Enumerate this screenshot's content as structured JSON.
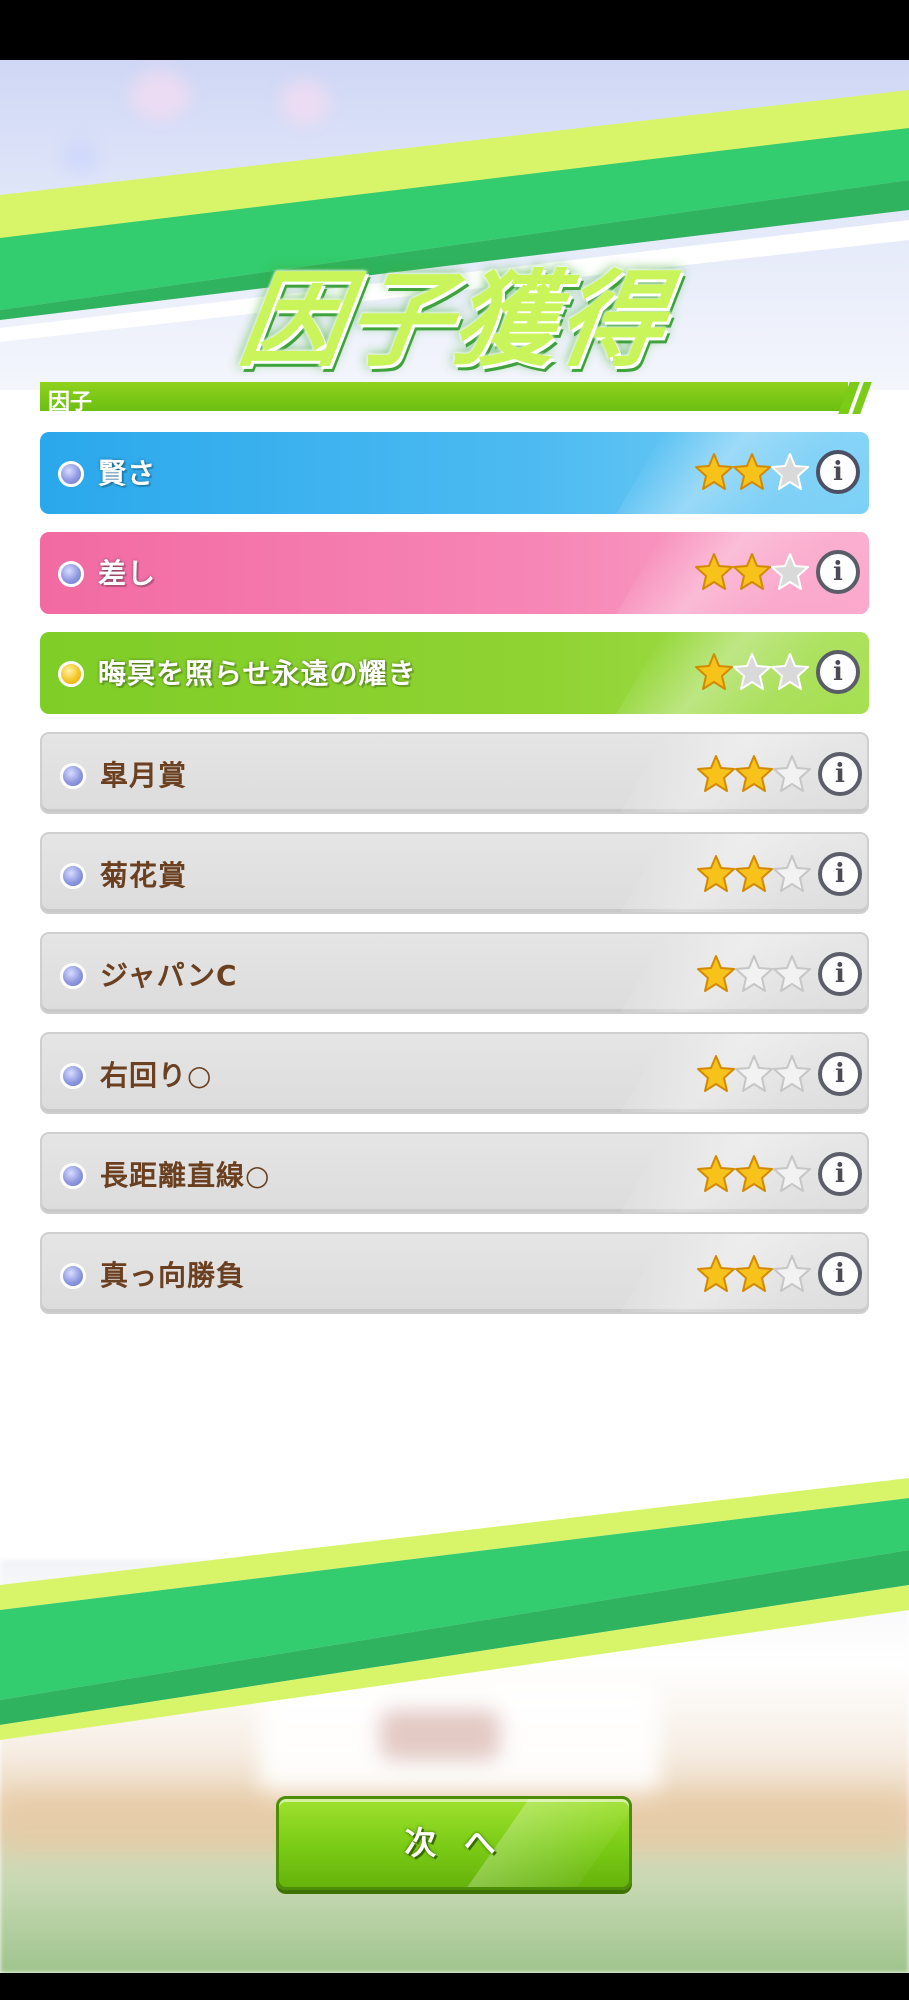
{
  "title": "因子獲得",
  "section_label": "因子",
  "factors": [
    {
      "name": "賢さ",
      "stars": 2,
      "max_stars": 3,
      "style": "blue"
    },
    {
      "name": "差し",
      "stars": 2,
      "max_stars": 3,
      "style": "pink"
    },
    {
      "name": "晦冥を照らせ永遠の耀き",
      "stars": 1,
      "max_stars": 3,
      "style": "green"
    },
    {
      "name": "皐月賞",
      "stars": 2,
      "max_stars": 3,
      "style": "gray"
    },
    {
      "name": "菊花賞",
      "stars": 2,
      "max_stars": 3,
      "style": "gray"
    },
    {
      "name": "ジャパンC",
      "stars": 1,
      "max_stars": 3,
      "style": "gray"
    },
    {
      "name": "右回り○",
      "stars": 1,
      "max_stars": 3,
      "style": "gray"
    },
    {
      "name": "長距離直線○",
      "stars": 2,
      "max_stars": 3,
      "style": "gray"
    },
    {
      "name": "真っ向勝負",
      "stars": 2,
      "max_stars": 3,
      "style": "gray"
    }
  ],
  "info_glyph": "i",
  "next_button_label": "次 へ",
  "colors": {
    "accent_green": "#7acb15",
    "blue_factor": "#2aa8ec",
    "pink_factor": "#f26aa2",
    "unique_factor": "#7fcd27",
    "gray_factor": "#dcdcdc",
    "star_filled": "#f7c21a"
  },
  "icons": {
    "bullet": "round-gem-icon",
    "star": "star-icon",
    "info": "info-icon"
  }
}
